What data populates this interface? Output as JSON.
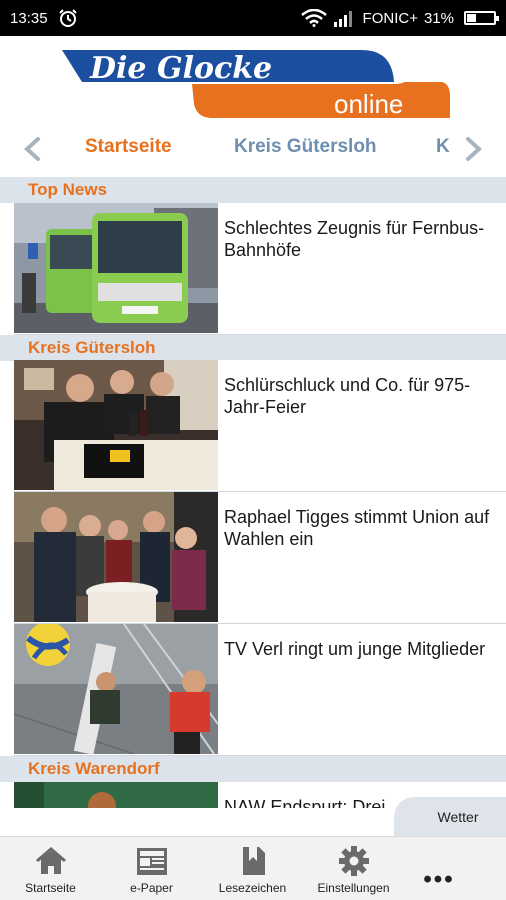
{
  "status_bar": {
    "time": "13:35",
    "carrier": "FONIC+",
    "battery": "31%",
    "battery_level": 0.31
  },
  "header": {
    "logo_main": "Die Glocke",
    "logo_sub": "online"
  },
  "tabs": [
    {
      "label": "Startseite",
      "active": true
    },
    {
      "label": "Kreis Gütersloh",
      "active": false
    },
    {
      "label": "K",
      "active": false
    }
  ],
  "sections": [
    {
      "title": "Top News"
    },
    {
      "title": "Kreis Gütersloh"
    },
    {
      "title": "Kreis Warendorf"
    }
  ],
  "articles": [
    {
      "headline": "Schlechtes Zeugnis für Fernbus-Bahnhöfe"
    },
    {
      "headline": "Schlürschluck und Co. für 975-Jahr-Feier"
    },
    {
      "headline": "Raphael Tigges stimmt Union auf Wahlen ein"
    },
    {
      "headline": "TV Verl ringt um junge Mitglieder"
    },
    {
      "headline": "NAW Endspurt: Drei"
    }
  ],
  "weather_label": "Wetter",
  "bottom_nav": [
    {
      "label": "Startseite",
      "icon": "home-icon"
    },
    {
      "label": "e-Paper",
      "icon": "newspaper-icon"
    },
    {
      "label": "Lesezeichen",
      "icon": "bookmark-icon"
    },
    {
      "label": "Einstellungen",
      "icon": "gear-icon"
    }
  ],
  "more_label": "•••",
  "colors": {
    "brand_blue": "#1d4fa0",
    "brand_orange": "#e8711f",
    "tab_inactive": "#6f8fb0",
    "section_bg": "#dde3ea"
  }
}
